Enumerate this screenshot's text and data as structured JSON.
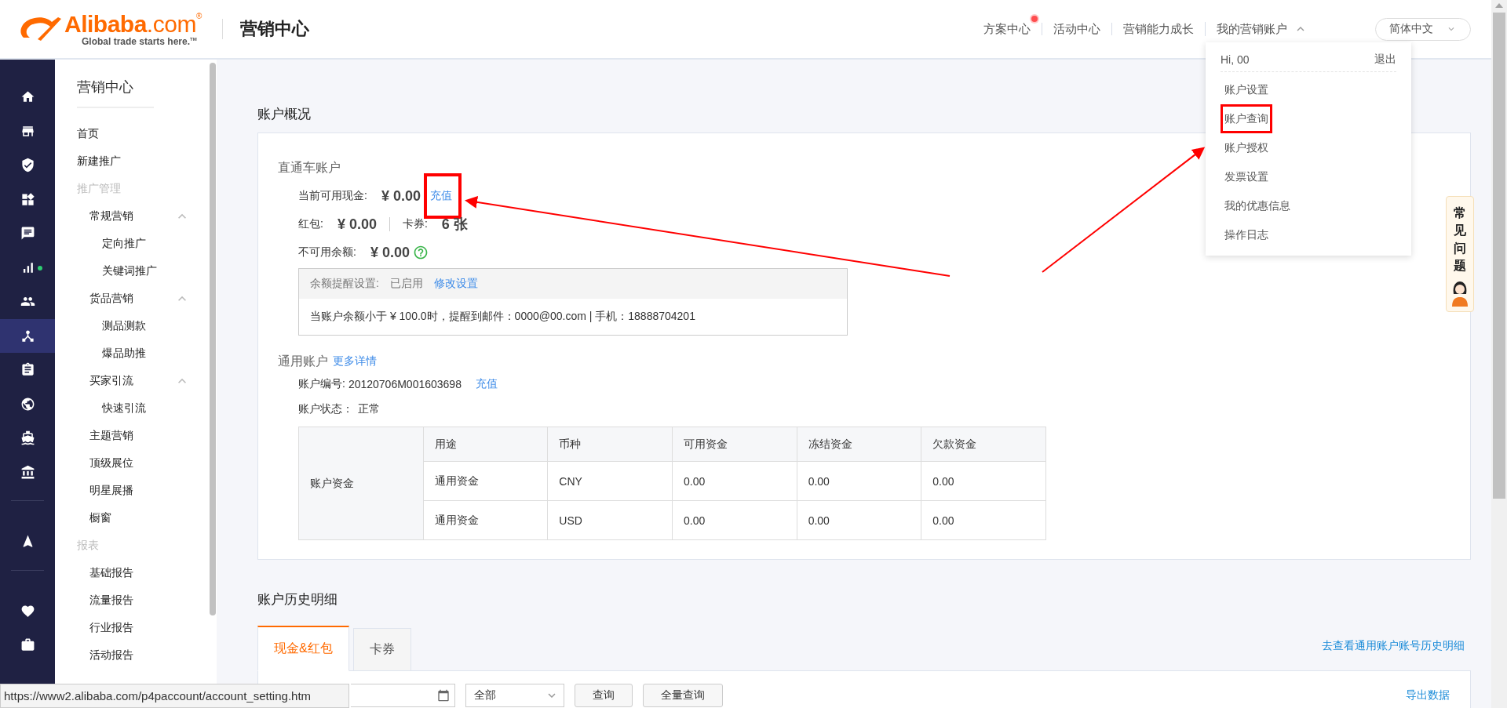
{
  "header": {
    "brand": "**Alibaba**.com$^{®}$",
    "tagline": "Global trade starts here.$^{TM}$",
    "title": "营销中心",
    "nav": [
      {
        "label": "方案中心",
        "dot": true
      },
      {
        "label": "活动中心",
        "dot": false
      },
      {
        "label": "营销能力成长",
        "dot": false
      }
    ],
    "account_menu": {
      "label": "我的营销账户",
      "expanded": true,
      "greeting": "Hi, 00",
      "logout": "退出",
      "items": [
        {
          "label": "账户设置",
          "annotated": false
        },
        {
          "label": "账户查询",
          "annotated": true
        },
        {
          "label": "账户授权",
          "annotated": false
        },
        {
          "label": "发票设置",
          "annotated": false
        },
        {
          "label": "我的优惠信息",
          "annotated": false
        },
        {
          "label": "操作日志",
          "annotated": false
        }
      ]
    },
    "language": "简体中文"
  },
  "rail": [
    [
      {
        "kind": "home",
        "selected": false,
        "dot": false
      },
      {
        "kind": "store",
        "selected": false,
        "dot": false
      },
      {
        "kind": "shield",
        "selected": false,
        "dot": false
      },
      {
        "kind": "widgets",
        "selected": false,
        "dot": false
      },
      {
        "kind": "chat",
        "selected": false,
        "dot": false
      },
      {
        "kind": "chart",
        "selected": false,
        "dot": true
      },
      {
        "kind": "people",
        "selected": false,
        "dot": false
      },
      {
        "kind": "hub",
        "selected": true,
        "dot": false
      },
      {
        "kind": "clipboard",
        "selected": false,
        "dot": false
      },
      {
        "kind": "globe",
        "selected": false,
        "dot": false
      },
      {
        "kind": "ship",
        "selected": false,
        "dot": false
      },
      {
        "kind": "bank",
        "selected": false,
        "dot": false
      }
    ],
    [
      {
        "kind": "send",
        "selected": false,
        "dot": false
      }
    ],
    [
      {
        "kind": "heart",
        "selected": false,
        "dot": false
      },
      {
        "kind": "briefcase",
        "selected": false,
        "dot": false
      }
    ]
  ],
  "menu": {
    "title": "营销中心",
    "items": [
      {
        "label": "首页",
        "kind": "link"
      },
      {
        "label": "新建推广",
        "kind": "link"
      },
      {
        "label": "推广管理",
        "kind": "heading",
        "children": [
          {
            "label": "常规营销",
            "kind": "group",
            "expanded": true,
            "children": [
              {
                "label": "定向推广",
                "kind": "link"
              },
              {
                "label": "关键词推广",
                "kind": "link"
              }
            ]
          },
          {
            "label": "货品营销",
            "kind": "group",
            "expanded": true,
            "children": [
              {
                "label": "测品测款",
                "kind": "link"
              },
              {
                "label": "爆品助推",
                "kind": "link"
              }
            ]
          },
          {
            "label": "买家引流",
            "kind": "group",
            "expanded": true,
            "children": [
              {
                "label": "快速引流",
                "kind": "link"
              }
            ]
          },
          {
            "label": "主题营销",
            "kind": "link"
          },
          {
            "label": "顶级展位",
            "kind": "link"
          },
          {
            "label": "明星展播",
            "kind": "link"
          },
          {
            "label": "橱窗",
            "kind": "link"
          }
        ]
      },
      {
        "label": "报表",
        "kind": "heading",
        "children": [
          {
            "label": "基础报告",
            "kind": "link"
          },
          {
            "label": "流量报告",
            "kind": "link"
          },
          {
            "label": "行业报告",
            "kind": "link"
          },
          {
            "label": "活动报告",
            "kind": "link"
          }
        ]
      }
    ]
  },
  "overview": {
    "title": "账户概况",
    "direct_account": {
      "title": "直通车账户",
      "cash": {
        "label": "当前可用现金:",
        "amount": "¥ 0.00",
        "action": "充值",
        "annotated": true
      },
      "red_packet": {
        "label": "红包:",
        "amount": "¥ 0.00"
      },
      "coupons": {
        "label": "卡券:",
        "amount": "6 张"
      },
      "unavailable": {
        "label": "不可用余额:",
        "amount": "¥ 0.00"
      },
      "reminder": {
        "label": "余额提醒设置:",
        "status": "已启用",
        "action": "修改设置",
        "message": "当账户余额小于 ¥ 100.0时，提醒到邮件：0000@00.com | 手机：18888704201"
      }
    },
    "general_account": {
      "title": "通用账户",
      "details_link": "更多详情",
      "number_label": "账户编号:",
      "number": "20120706M001603698",
      "recharge": "充值",
      "status_label": "账户状态：",
      "status": "正常",
      "table": {
        "row_header": "账户资金",
        "columns": [
          "用途",
          "币种",
          "可用资金",
          "冻结资金",
          "欠款资金"
        ],
        "rows": [
          [
            "通用资金",
            "CNY",
            "0.00",
            "0.00",
            "0.00"
          ],
          [
            "通用资金",
            "USD",
            "0.00",
            "0.00",
            "0.00"
          ]
        ]
      }
    }
  },
  "history": {
    "title": "账户历史明细",
    "tabs": [
      {
        "label": "现金&红包",
        "selected": true
      },
      {
        "label": "卡券",
        "selected": false
      }
    ],
    "link": "去查看通用账户账号历史明细",
    "filter": {
      "select": "全部",
      "buttons": [
        "查询",
        "全量查询"
      ],
      "export": "导出数据"
    }
  },
  "help_float": {
    "label": "常见问题"
  },
  "status_bar": {
    "url": "https://www2.alibaba.com/p4paccount/account_setting.htm"
  }
}
